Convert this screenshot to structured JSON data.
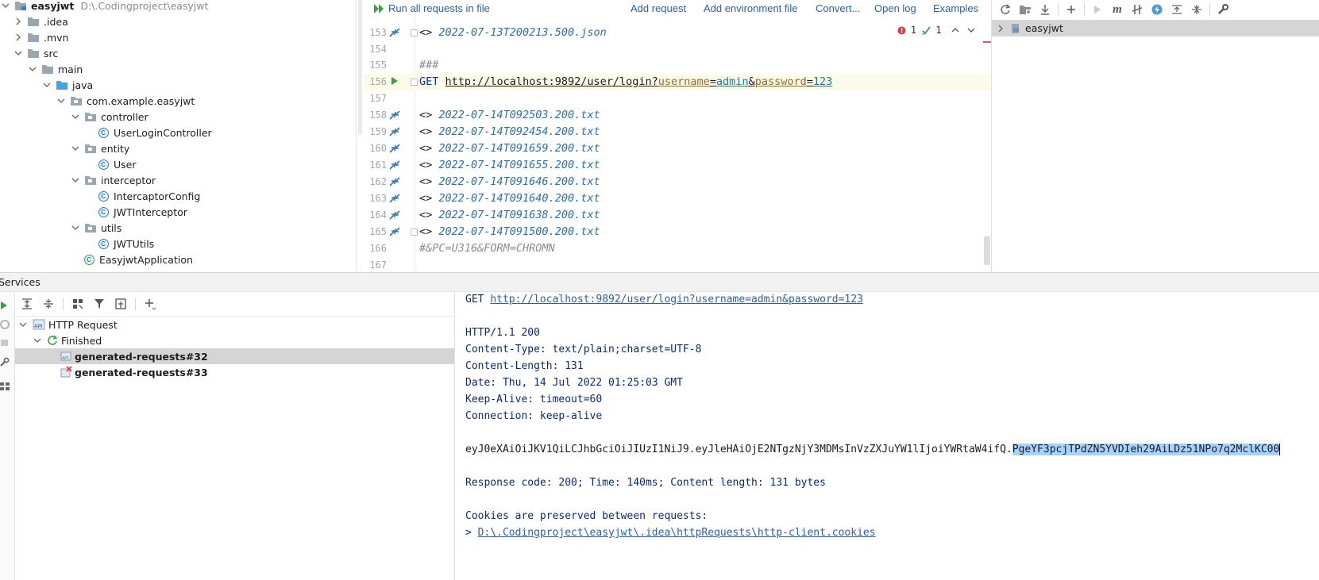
{
  "project_tree": {
    "root": {
      "name": "easyjwt",
      "path": "D:\\.Codingproject\\easyjwt"
    },
    "items": [
      {
        "label": ".idea",
        "kind": "folder"
      },
      {
        "label": ".mvn",
        "kind": "folder"
      },
      {
        "label": "src",
        "kind": "folder"
      },
      {
        "label": "main",
        "kind": "folder"
      },
      {
        "label": "java",
        "kind": "source-folder"
      },
      {
        "label": "com.example.easyjwt",
        "kind": "package"
      },
      {
        "label": "controller",
        "kind": "package"
      },
      {
        "label": "UserLoginController",
        "kind": "class"
      },
      {
        "label": "entity",
        "kind": "package"
      },
      {
        "label": "User",
        "kind": "class"
      },
      {
        "label": "interceptor",
        "kind": "package"
      },
      {
        "label": "IntercaptorConfig",
        "kind": "class"
      },
      {
        "label": "JWTInterceptor",
        "kind": "class"
      },
      {
        "label": "utils",
        "kind": "package"
      },
      {
        "label": "JWTUtils",
        "kind": "class"
      },
      {
        "label": "EasyjwtApplication",
        "kind": "spring-class"
      }
    ]
  },
  "editor_toolbar": {
    "run_all": "Run all requests in file",
    "add_request": "Add request",
    "add_env": "Add environment file",
    "convert": "Convert...",
    "open_log": "Open log",
    "examples": "Examples"
  },
  "inspections": {
    "errors": "1",
    "warnings": "1"
  },
  "editor": {
    "lines": [
      {
        "num": "153",
        "prefix": "<> ",
        "text": "2022-07-13T200213.500.json"
      },
      {
        "num": "154"
      },
      {
        "num": "155",
        "comment": "###"
      },
      {
        "num": "156",
        "method": "GET",
        "url_base": "http://localhost:9892/user/login?",
        "p1k": "username",
        "eq1": "=",
        "p1v": "admin",
        "amp": "&",
        "p2k": "password",
        "eq2": "=",
        "p2v": "123"
      },
      {
        "num": "157"
      },
      {
        "num": "158",
        "prefix": "<> ",
        "text": "2022-07-14T092503.200.txt"
      },
      {
        "num": "159",
        "prefix": "<> ",
        "text": "2022-07-14T092454.200.txt"
      },
      {
        "num": "160",
        "prefix": "<> ",
        "text": "2022-07-14T091659.200.txt"
      },
      {
        "num": "161",
        "prefix": "<> ",
        "text": "2022-07-14T091655.200.txt"
      },
      {
        "num": "162",
        "prefix": "<> ",
        "text": "2022-07-14T091646.200.txt"
      },
      {
        "num": "163",
        "prefix": "<> ",
        "text": "2022-07-14T091640.200.txt"
      },
      {
        "num": "164",
        "prefix": "<> ",
        "text": "2022-07-14T091638.200.txt"
      },
      {
        "num": "165",
        "prefix": "<> ",
        "text": "2022-07-14T091500.200.txt"
      },
      {
        "num": "166",
        "comment": "#&PC=U316&FORM=CHROMN"
      },
      {
        "num": "167"
      }
    ]
  },
  "right_panel": {
    "item": "easyjwt"
  },
  "services": {
    "title": "Services",
    "tree": {
      "root": "HTTP Request",
      "group": "Finished",
      "items": [
        "generated-requests#32",
        "generated-requests#33"
      ]
    }
  },
  "response": {
    "request_method": "GET",
    "request_url": "http://localhost:9892/user/login?username=admin&password=123",
    "status": "HTTP/1.1 200",
    "headers": [
      "Content-Type: text/plain;charset=UTF-8",
      "Content-Length: 131",
      "Date: Thu, 14 Jul 2022 01:25:03 GMT",
      "Keep-Alive: timeout=60",
      "Connection: keep-alive"
    ],
    "body_plain": "eyJ0eXAiOiJKV1QiLCJhbGciOiJIUzI1NiJ9.eyJleHAiOjE2NTgzNjY3MDMsInVzZXJuYW1lIjoiYWRtaW4ifQ.",
    "body_selected": "PgeYF3pcjTPdZN5YVDIeh29AiLDz51NPo7q2MclKC00",
    "summary": "Response code: 200; Time: 140ms; Content length: 131 bytes",
    "cookies_label": "Cookies are preserved between requests:",
    "cookies_prefix": "> ",
    "cookies_path": "D:\\.Codingproject\\easyjwt\\.idea\\httpRequests\\http-client.cookies"
  },
  "colors": {
    "link": "#2a5fb0",
    "selection": "#a6d2ff",
    "selected_row": "#d5d5d5",
    "current_line": "#fcfae9"
  }
}
